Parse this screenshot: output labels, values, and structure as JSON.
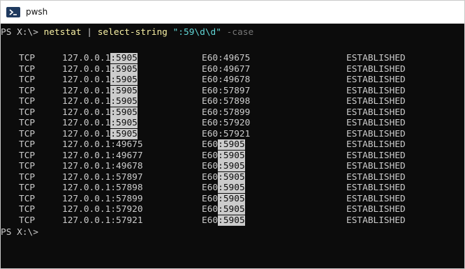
{
  "window": {
    "title": "pwsh",
    "icon": "powershell-icon"
  },
  "terminal": {
    "prompt": "PS X:\\> ",
    "command": {
      "cmd1": "netstat",
      "pipe": " | ",
      "cmd2": "select-string",
      "arg": "\":59\\d\\d\"",
      "flag": "-case"
    },
    "match_text": ":5905",
    "rows": [
      {
        "proto": "TCP",
        "local": "127.0.0.1:5905",
        "foreign": "E60:49675",
        "state": "ESTABLISHED"
      },
      {
        "proto": "TCP",
        "local": "127.0.0.1:5905",
        "foreign": "E60:49677",
        "state": "ESTABLISHED"
      },
      {
        "proto": "TCP",
        "local": "127.0.0.1:5905",
        "foreign": "E60:49678",
        "state": "ESTABLISHED"
      },
      {
        "proto": "TCP",
        "local": "127.0.0.1:5905",
        "foreign": "E60:57897",
        "state": "ESTABLISHED"
      },
      {
        "proto": "TCP",
        "local": "127.0.0.1:5905",
        "foreign": "E60:57898",
        "state": "ESTABLISHED"
      },
      {
        "proto": "TCP",
        "local": "127.0.0.1:5905",
        "foreign": "E60:57899",
        "state": "ESTABLISHED"
      },
      {
        "proto": "TCP",
        "local": "127.0.0.1:5905",
        "foreign": "E60:57920",
        "state": "ESTABLISHED"
      },
      {
        "proto": "TCP",
        "local": "127.0.0.1:5905",
        "foreign": "E60:57921",
        "state": "ESTABLISHED"
      },
      {
        "proto": "TCP",
        "local": "127.0.0.1:49675",
        "foreign": "E60:5905",
        "state": "ESTABLISHED"
      },
      {
        "proto": "TCP",
        "local": "127.0.0.1:49677",
        "foreign": "E60:5905",
        "state": "ESTABLISHED"
      },
      {
        "proto": "TCP",
        "local": "127.0.0.1:49678",
        "foreign": "E60:5905",
        "state": "ESTABLISHED"
      },
      {
        "proto": "TCP",
        "local": "127.0.0.1:57897",
        "foreign": "E60:5905",
        "state": "ESTABLISHED"
      },
      {
        "proto": "TCP",
        "local": "127.0.0.1:57898",
        "foreign": "E60:5905",
        "state": "ESTABLISHED"
      },
      {
        "proto": "TCP",
        "local": "127.0.0.1:57899",
        "foreign": "E60:5905",
        "state": "ESTABLISHED"
      },
      {
        "proto": "TCP",
        "local": "127.0.0.1:57920",
        "foreign": "E60:5905",
        "state": "ESTABLISHED"
      },
      {
        "proto": "TCP",
        "local": "127.0.0.1:57921",
        "foreign": "E60:5905",
        "state": "ESTABLISHED"
      }
    ],
    "final_prompt": "PS X:\\>",
    "colors": {
      "background": "#0c0c0c",
      "foreground": "#cccccc",
      "command": "#f9f1a5",
      "string": "#61d6d6",
      "parameter": "#767676",
      "highlight_bg": "#cccccc",
      "highlight_fg": "#0c0c0c"
    }
  }
}
